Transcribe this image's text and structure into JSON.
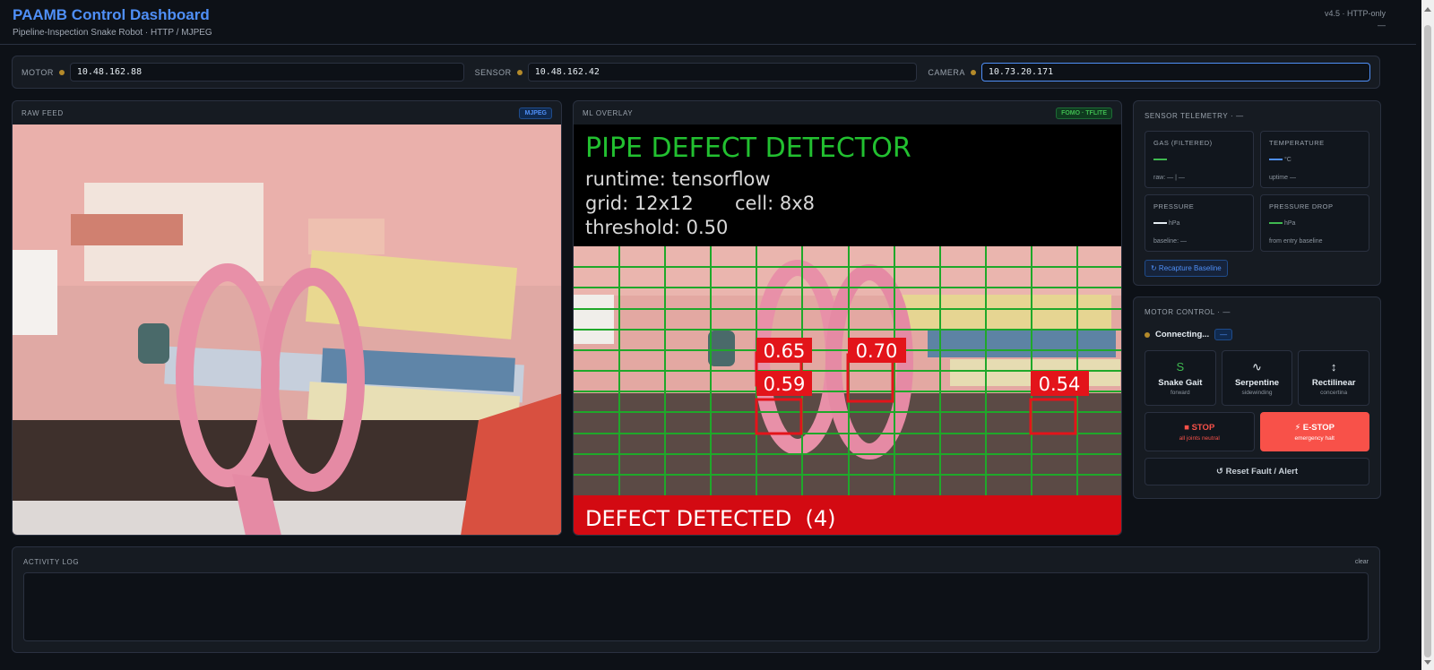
{
  "header": {
    "title": "PAAMB Control Dashboard",
    "subtitle": "Pipeline-Inspection Snake Robot · HTTP / MJPEG",
    "version": "v4.5 · HTTP-only",
    "status": "—"
  },
  "ip_bar": {
    "motor": {
      "label": "MOTOR",
      "value": "10.48.162.88"
    },
    "sensor": {
      "label": "SENSOR",
      "value": "10.48.162.42"
    },
    "camera": {
      "label": "CAMERA",
      "value": "10.73.20.171"
    }
  },
  "raw_feed": {
    "title": "RAW FEED",
    "badge": "MJPEG"
  },
  "ml_feed": {
    "title": "ML OVERLAY",
    "badge": "FOMO · TFLITE",
    "overlay_title": "PIPE DEFECT DETECTOR",
    "runtime": "runtime: tensorflow",
    "grid": "grid: 12x12",
    "cell": "cell: 8x8",
    "threshold": "threshold: 0.50",
    "detections": [
      "0.65",
      "0.70",
      "0.59",
      "0.54"
    ],
    "footer": "DEFECT DETECTED  (4)"
  },
  "telemetry": {
    "title": "SENSOR TELEMETRY · —",
    "gas": {
      "label": "GAS (FILTERED)",
      "sub": "raw: — | —"
    },
    "temperature": {
      "label": "TEMPERATURE",
      "unit": "°C",
      "sub": "uptime —"
    },
    "pressure": {
      "label": "PRESSURE",
      "unit": "hPa",
      "sub": "baseline: —"
    },
    "pressure_drop": {
      "label": "PRESSURE DROP",
      "unit": "hPa",
      "sub": "from entry baseline"
    },
    "recapture_label": "↻ Recapture Baseline"
  },
  "motor": {
    "title": "MOTOR CONTROL · —",
    "status": "Connecting...",
    "status_badge": "—",
    "gaits": [
      {
        "icon": "S",
        "name": "Snake Gait",
        "sub": "forward"
      },
      {
        "icon": "∿",
        "name": "Serpentine",
        "sub": "sidewinding"
      },
      {
        "icon": "↕",
        "name": "Rectilinear",
        "sub": "concertina"
      }
    ],
    "stop": {
      "name": "■ STOP",
      "sub": "all joints neutral"
    },
    "estop": {
      "name": "⚡ E-STOP",
      "sub": "emergency halt"
    },
    "reset_label": "↺ Reset Fault / Alert"
  },
  "log": {
    "title": "ACTIVITY LOG",
    "clear_label": "clear"
  },
  "colors": {
    "accent": "#4f8ff7",
    "ok": "#3fb950",
    "danger": "#f85149",
    "warn": "#b48a2a"
  }
}
